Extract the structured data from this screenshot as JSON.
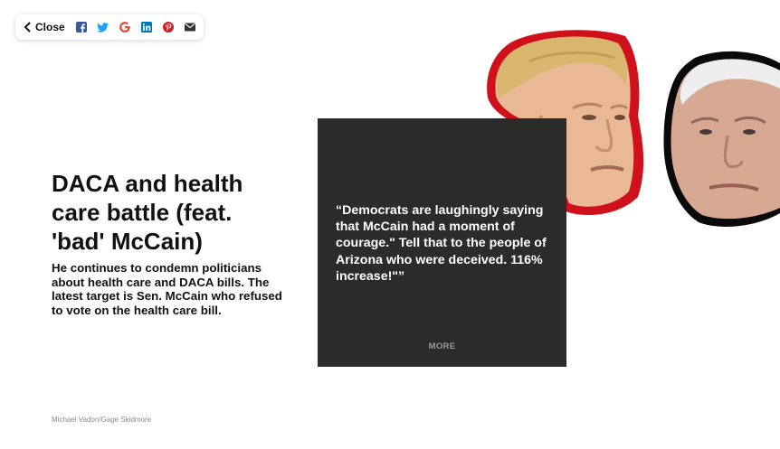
{
  "toolbar": {
    "close_label": "Close",
    "share_icons": [
      "facebook-icon",
      "twitter-icon",
      "google-icon",
      "linkedin-icon",
      "pinterest-icon",
      "email-icon"
    ]
  },
  "article": {
    "headline": "DACA and health care battle (feat. 'bad' McCain)",
    "subhead": "He continues to condemn politicians about health care and DACA bills. The latest target is Sen. McCain who refused to vote on the health care bill.",
    "credit": "Michael Vadon/Gage Skidmore"
  },
  "quote_card": {
    "text": "“Democrats are laughingly saying that McCain had a moment of courage.\" Tell that to the people of Arizona who were deceived. 116% increase!\"”",
    "more_label": "MORE",
    "background": "#2b2b2b"
  },
  "colors": {
    "trump_outline": "#d0101a",
    "mccain_outline": "#0a0a0a",
    "facebook": "#3b5998",
    "twitter": "#1da1f2",
    "google": "#dd4b39",
    "linkedin": "#0077b5",
    "pinterest": "#cb2027",
    "email": "#333333"
  }
}
